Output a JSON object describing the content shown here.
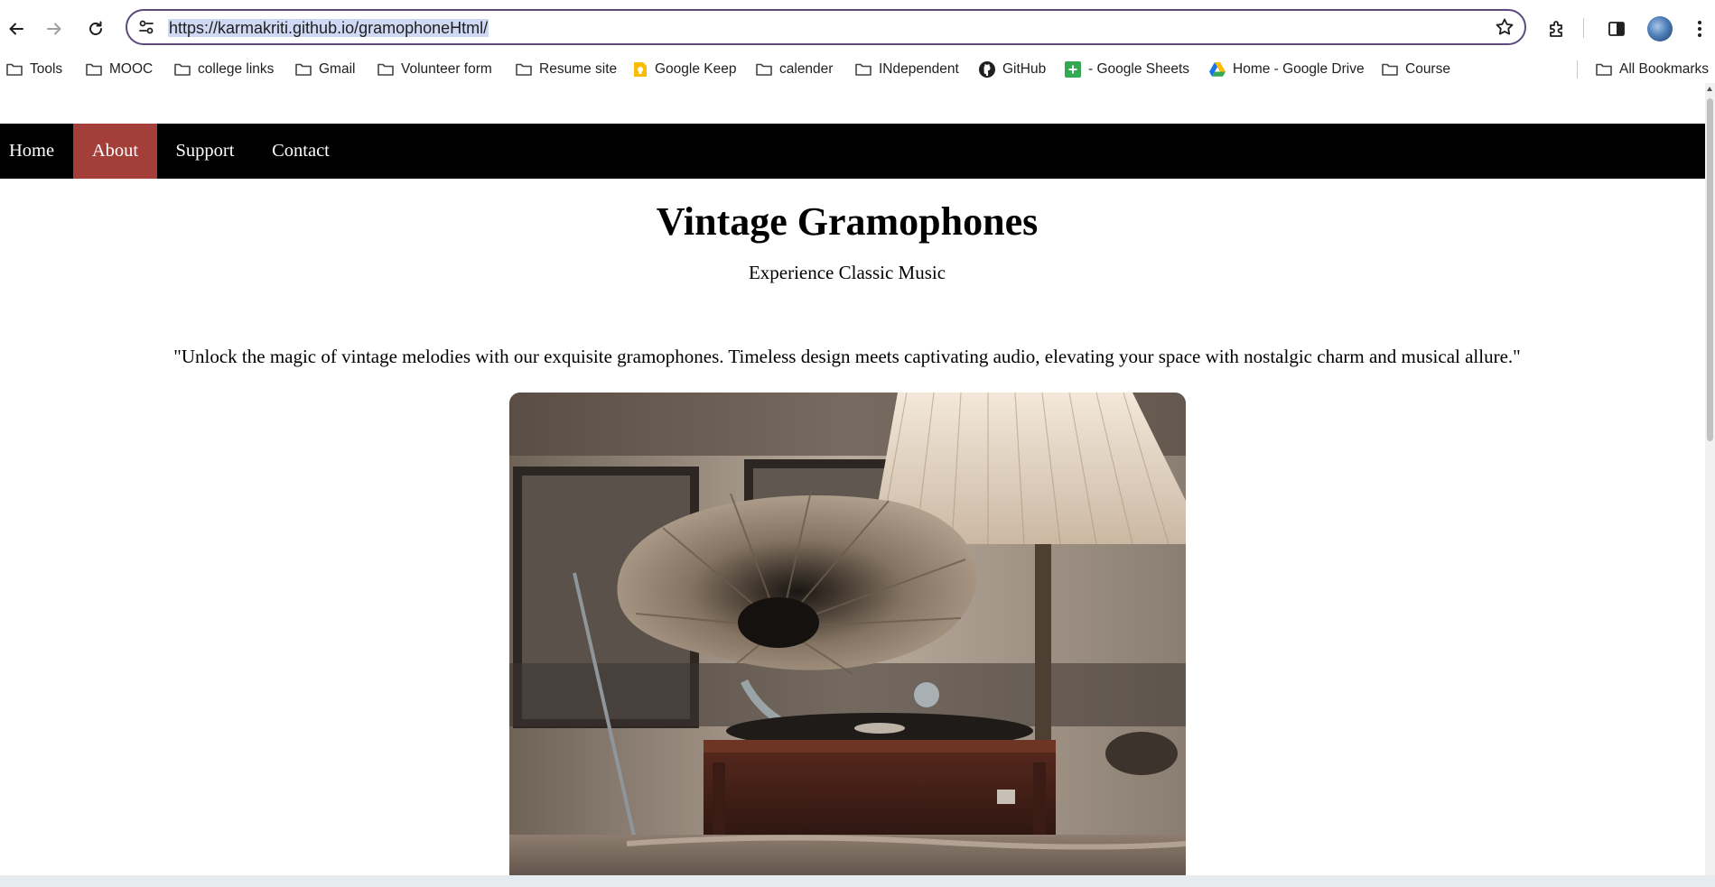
{
  "browser": {
    "url": "https://karmakriti.github.io/gramophoneHtml/"
  },
  "bookmarks": {
    "items": [
      {
        "label": "Tools",
        "icon": "folder-icon"
      },
      {
        "label": "MOOC",
        "icon": "folder-icon"
      },
      {
        "label": "college links",
        "icon": "folder-icon"
      },
      {
        "label": "Gmail",
        "icon": "folder-icon"
      },
      {
        "label": "Volunteer form",
        "icon": "folder-icon"
      },
      {
        "label": "Resume site",
        "icon": "folder-icon"
      },
      {
        "label": "Google Keep",
        "icon": "keep-icon"
      },
      {
        "label": "calender",
        "icon": "folder-icon"
      },
      {
        "label": "INdependent",
        "icon": "folder-icon"
      },
      {
        "label": "GitHub",
        "icon": "github-icon"
      },
      {
        "label": "- Google Sheets",
        "icon": "sheets-icon"
      },
      {
        "label": "Home - Google Drive",
        "icon": "drive-icon"
      },
      {
        "label": "Course",
        "icon": "folder-icon"
      }
    ],
    "all_bookmarks": "All Bookmarks"
  },
  "nav": {
    "items": [
      {
        "label": "Home",
        "active": false
      },
      {
        "label": "About",
        "active": true
      },
      {
        "label": "Support",
        "active": false
      },
      {
        "label": "Contact",
        "active": false
      }
    ],
    "active_color": "#a33e38",
    "background": "#000000"
  },
  "page": {
    "title": "Vintage Gramophones",
    "subtitle": "Experience Classic Music",
    "quote": "\"Unlock the magic of vintage melodies with our exquisite gramophones. Timeless design meets captivating audio, elevating your space with nostalgic charm and musical allure.\""
  },
  "colors": {
    "omnibox_border": "#5c4a7d",
    "url_highlight": "#cfd9f3"
  }
}
